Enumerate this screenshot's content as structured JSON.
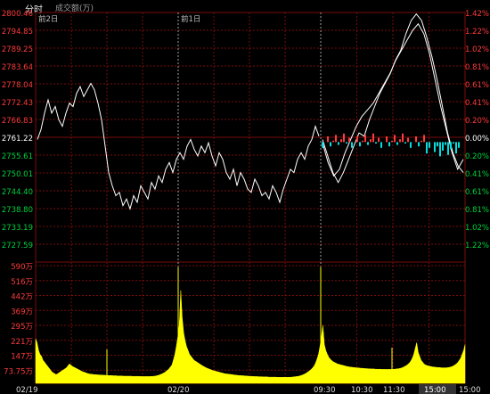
{
  "header": {
    "title": "分时",
    "subtitle": "成交额(万)"
  },
  "colors": {
    "up": "#ff3b3b",
    "down": "#00d23c",
    "flat": "#ffffff",
    "grid": "#7a0b0b",
    "volume": "#ffff00",
    "price_line": "#ffffff"
  },
  "chart_data": [
    {
      "type": "line",
      "title": "",
      "y_ticks": [
        "2800.46",
        "2794.85",
        "2789.25",
        "2783.64",
        "2778.04",
        "2772.43",
        "2766.83",
        "2761.22",
        "2755.61",
        "2750.01",
        "2744.40",
        "2738.80",
        "2733.19",
        "2727.59"
      ],
      "right_ticks": [
        "1.42%",
        "1.22%",
        "1.02%",
        "0.81%",
        "0.61%",
        "0.41%",
        "0.20%",
        "0.00%",
        "0.20%",
        "0.41%",
        "0.61%",
        "0.81%",
        "1.02%",
        "1.22%"
      ],
      "reference": 2761.22,
      "ylim": [
        2727.59,
        2800.46
      ],
      "day_labels": [
        "前2日",
        "前1日"
      ],
      "series": [
        {
          "values": [
            2762,
            2765,
            2770,
            2774,
            2770,
            2772,
            2768,
            2766,
            2770,
            2773,
            2772,
            2776,
            2778,
            2775,
            2777,
            2779,
            2777,
            2773,
            2768,
            2760,
            2752,
            2748,
            2745,
            2746,
            2742,
            2744,
            2741,
            2745,
            2743,
            2748,
            2746,
            2744,
            2749,
            2747,
            2751,
            2749,
            2753,
            2755,
            2752,
            2756,
            2758,
            2756,
            2760,
            2762,
            2759,
            2757,
            2760,
            2758,
            2761,
            2757,
            2754,
            2758,
            2756,
            2752,
            2750,
            2753,
            2748,
            2752,
            2750,
            2747,
            2746,
            2750,
            2748,
            2745,
            2746,
            2744,
            2748,
            2746,
            2743,
            2747,
            2750,
            2753,
            2752,
            2756,
            2758,
            2756,
            2760,
            2762,
            2766,
            2763
          ]
        },
        {
          "values": [
            2762,
            2757,
            2752,
            2749,
            2752,
            2756,
            2760,
            2764,
            2763,
            2768,
            2772,
            2776,
            2779,
            2782,
            2786,
            2789,
            2794,
            2798,
            2800,
            2798,
            2793,
            2787,
            2780,
            2772,
            2764,
            2758,
            2754,
            2752
          ]
        },
        {
          "values": [
            2761,
            2755,
            2751,
            2753,
            2758,
            2762,
            2766,
            2769,
            2771,
            2773,
            2776,
            2779,
            2782,
            2786,
            2789,
            2792,
            2795,
            2797,
            2794,
            2788,
            2780,
            2772,
            2765,
            2758,
            2753,
            2756
          ]
        }
      ]
    },
    {
      "type": "area",
      "title": "",
      "y_ticks": [
        "590万",
        "516万",
        "442万",
        "369万",
        "295万",
        "221万",
        "147万",
        "73.75万"
      ],
      "ylim": [
        0,
        590
      ],
      "x_labels": [
        "02/19",
        "02/20",
        "09:30",
        "10:30",
        "11:30",
        "15:00",
        "15:00"
      ],
      "series": [
        {
          "name": "",
          "values": [
            230,
            210,
            170,
            150,
            140,
            120,
            110,
            100,
            90,
            80,
            70,
            60,
            55,
            50,
            45,
            50,
            55,
            60,
            65,
            70,
            75,
            80,
            90,
            100,
            95,
            88,
            84,
            80,
            76,
            72,
            68,
            64,
            60,
            58,
            55,
            52,
            50,
            48,
            47,
            46,
            45,
            45,
            44,
            44,
            43,
            43,
            42,
            42,
            41,
            41,
            40,
            40,
            40,
            39,
            39,
            39,
            38,
            38,
            38,
            38,
            37,
            37,
            37,
            37,
            37,
            37,
            36,
            36,
            36,
            36,
            36,
            36,
            35,
            35,
            35,
            35,
            35,
            35,
            35,
            36,
            36,
            37,
            38,
            40,
            42,
            45,
            48,
            52,
            56,
            62,
            68,
            75,
            85,
            95,
            120,
            150,
            190,
            240,
            300,
            480,
            340,
            260,
            220,
            190,
            170,
            150,
            140,
            130,
            120,
            115,
            110,
            105,
            100,
            95,
            90,
            86,
            82,
            78,
            75,
            72,
            69,
            66,
            64,
            62,
            60,
            58,
            56,
            54,
            52,
            50,
            49,
            48,
            47,
            46,
            45,
            44,
            43,
            42,
            41,
            40,
            40,
            39,
            39,
            38,
            38,
            37,
            37,
            36,
            36,
            35,
            35,
            35,
            34,
            34,
            34,
            33,
            33,
            33,
            33,
            32,
            32,
            32,
            32,
            32,
            32,
            31,
            31,
            31,
            31,
            31,
            31,
            31,
            31,
            31,
            32,
            32,
            33,
            34,
            35,
            36,
            38,
            40,
            43,
            46,
            50,
            55,
            60,
            66,
            72,
            80,
            90,
            105,
            125,
            150,
            190,
            240,
            300,
            200,
            170,
            150,
            135,
            125,
            118,
            112,
            108,
            104,
            100,
            98,
            96,
            94,
            92,
            90,
            88,
            86,
            85,
            84,
            83,
            82,
            81,
            80,
            80,
            79,
            78,
            78,
            77,
            76,
            76,
            75,
            75,
            74,
            74,
            74,
            73,
            73,
            73,
            73,
            72,
            72,
            72,
            72,
            72,
            72,
            72,
            72,
            73,
            73,
            74,
            75,
            76,
            78,
            80,
            84,
            88,
            92,
            98,
            105,
            115,
            130,
            150,
            180,
            210,
            160,
            140,
            120,
            110,
            100,
            95,
            92,
            90,
            88,
            86,
            85,
            84,
            83,
            82,
            82,
            81,
            80,
            80,
            80,
            80,
            81,
            82,
            84,
            86,
            90,
            95,
            100,
            108,
            118,
            130,
            150,
            170,
            200
          ]
        }
      ]
    }
  ]
}
